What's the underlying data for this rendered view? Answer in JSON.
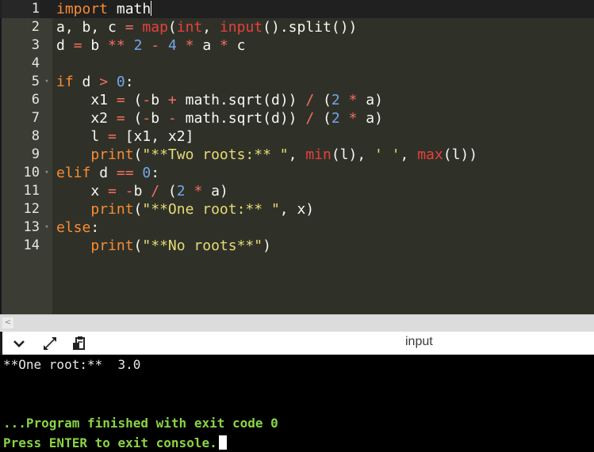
{
  "editor": {
    "active_line": 1,
    "lines": [
      {
        "n": "1",
        "fold": "",
        "tokens": [
          [
            "kw",
            "import"
          ],
          [
            "var",
            " math"
          ]
        ],
        "cursor": true
      },
      {
        "n": "2",
        "fold": "",
        "tokens": [
          [
            "var",
            "a, b, c "
          ],
          [
            "op",
            "="
          ],
          [
            "var",
            " "
          ],
          [
            "bi",
            "map"
          ],
          [
            "prn",
            "("
          ],
          [
            "bi",
            "int"
          ],
          [
            "var",
            ", "
          ],
          [
            "bi",
            "input"
          ],
          [
            "prn",
            "()"
          ],
          [
            "var",
            "."
          ],
          [
            "fn",
            "split"
          ],
          [
            "prn",
            "())"
          ]
        ]
      },
      {
        "n": "3",
        "fold": "",
        "tokens": [
          [
            "var",
            "d "
          ],
          [
            "op",
            "="
          ],
          [
            "var",
            " b "
          ],
          [
            "op",
            "**"
          ],
          [
            "var",
            " "
          ],
          [
            "num",
            "2"
          ],
          [
            "var",
            " "
          ],
          [
            "op",
            "-"
          ],
          [
            "var",
            " "
          ],
          [
            "num",
            "4"
          ],
          [
            "var",
            " "
          ],
          [
            "op",
            "*"
          ],
          [
            "var",
            " a "
          ],
          [
            "op",
            "*"
          ],
          [
            "var",
            " c"
          ]
        ]
      },
      {
        "n": "4",
        "fold": "",
        "tokens": []
      },
      {
        "n": "5",
        "fold": "▾",
        "tokens": [
          [
            "kw",
            "if"
          ],
          [
            "var",
            " d "
          ],
          [
            "op",
            ">"
          ],
          [
            "var",
            " "
          ],
          [
            "num",
            "0"
          ],
          [
            "var",
            ":"
          ]
        ]
      },
      {
        "n": "6",
        "fold": "",
        "tokens": [
          [
            "var",
            "    x1 "
          ],
          [
            "op",
            "="
          ],
          [
            "var",
            " ("
          ],
          [
            "op",
            "-"
          ],
          [
            "var",
            "b "
          ],
          [
            "op",
            "+"
          ],
          [
            "var",
            " math."
          ],
          [
            "fn",
            "sqrt"
          ],
          [
            "var",
            "(d)) "
          ],
          [
            "op",
            "/"
          ],
          [
            "var",
            " ("
          ],
          [
            "num",
            "2"
          ],
          [
            "var",
            " "
          ],
          [
            "op",
            "*"
          ],
          [
            "var",
            " a)"
          ]
        ]
      },
      {
        "n": "7",
        "fold": "",
        "tokens": [
          [
            "var",
            "    x2 "
          ],
          [
            "op",
            "="
          ],
          [
            "var",
            " ("
          ],
          [
            "op",
            "-"
          ],
          [
            "var",
            "b "
          ],
          [
            "op",
            "-"
          ],
          [
            "var",
            " math."
          ],
          [
            "fn",
            "sqrt"
          ],
          [
            "var",
            "(d)) "
          ],
          [
            "op",
            "/"
          ],
          [
            "var",
            " ("
          ],
          [
            "num",
            "2"
          ],
          [
            "var",
            " "
          ],
          [
            "op",
            "*"
          ],
          [
            "var",
            " a)"
          ]
        ]
      },
      {
        "n": "8",
        "fold": "",
        "tokens": [
          [
            "var",
            "    l "
          ],
          [
            "op",
            "="
          ],
          [
            "var",
            " [x1, x2]"
          ]
        ]
      },
      {
        "n": "9",
        "fold": "",
        "tokens": [
          [
            "var",
            "    "
          ],
          [
            "kw",
            "print"
          ],
          [
            "prn",
            "("
          ],
          [
            "str",
            "\"**Two roots:** \""
          ],
          [
            "var",
            ", "
          ],
          [
            "bi",
            "min"
          ],
          [
            "var",
            "(l), "
          ],
          [
            "str",
            "' '"
          ],
          [
            "var",
            ", "
          ],
          [
            "bi",
            "max"
          ],
          [
            "var",
            "(l))"
          ]
        ]
      },
      {
        "n": "10",
        "fold": "▾",
        "tokens": [
          [
            "kw",
            "elif"
          ],
          [
            "var",
            " d "
          ],
          [
            "op",
            "=="
          ],
          [
            "var",
            " "
          ],
          [
            "num",
            "0"
          ],
          [
            "var",
            ":"
          ]
        ]
      },
      {
        "n": "11",
        "fold": "",
        "tokens": [
          [
            "var",
            "    x "
          ],
          [
            "op",
            "="
          ],
          [
            "var",
            " "
          ],
          [
            "op",
            "-"
          ],
          [
            "var",
            "b "
          ],
          [
            "op",
            "/"
          ],
          [
            "var",
            " ("
          ],
          [
            "num",
            "2"
          ],
          [
            "var",
            " "
          ],
          [
            "op",
            "*"
          ],
          [
            "var",
            " a)"
          ]
        ]
      },
      {
        "n": "12",
        "fold": "",
        "tokens": [
          [
            "var",
            "    "
          ],
          [
            "kw",
            "print"
          ],
          [
            "prn",
            "("
          ],
          [
            "str",
            "\"**One root:** \""
          ],
          [
            "var",
            ", x)"
          ]
        ]
      },
      {
        "n": "13",
        "fold": "▾",
        "tokens": [
          [
            "kw",
            "else"
          ],
          [
            "var",
            ":"
          ]
        ]
      },
      {
        "n": "14",
        "fold": "",
        "tokens": [
          [
            "var",
            "    "
          ],
          [
            "kw",
            "print"
          ],
          [
            "prn",
            "("
          ],
          [
            "str",
            "\"**No roots**\""
          ],
          [
            "prn",
            ")"
          ]
        ]
      }
    ]
  },
  "scrollbar": {
    "left_arrow": "<"
  },
  "console": {
    "title": "input",
    "toolbar": {
      "collapse_icon": "chevron-down-icon",
      "expand_icon": "expand-icon",
      "clipboard_icon": "clipboard-icon"
    },
    "output_line": "**One root:**  3.0",
    "finished_line": "...Program finished with exit code 0",
    "press_line": "Press ENTER to exit console."
  },
  "colors": {
    "editor_bg": "#2f3129",
    "gutter_bg": "#3b3d35",
    "keyword": "#f98c34",
    "operator": "#f46d5f",
    "builtin": "#e8403a",
    "number": "#74a7e8",
    "string": "#e7db74",
    "console_green": "#8ad346"
  }
}
